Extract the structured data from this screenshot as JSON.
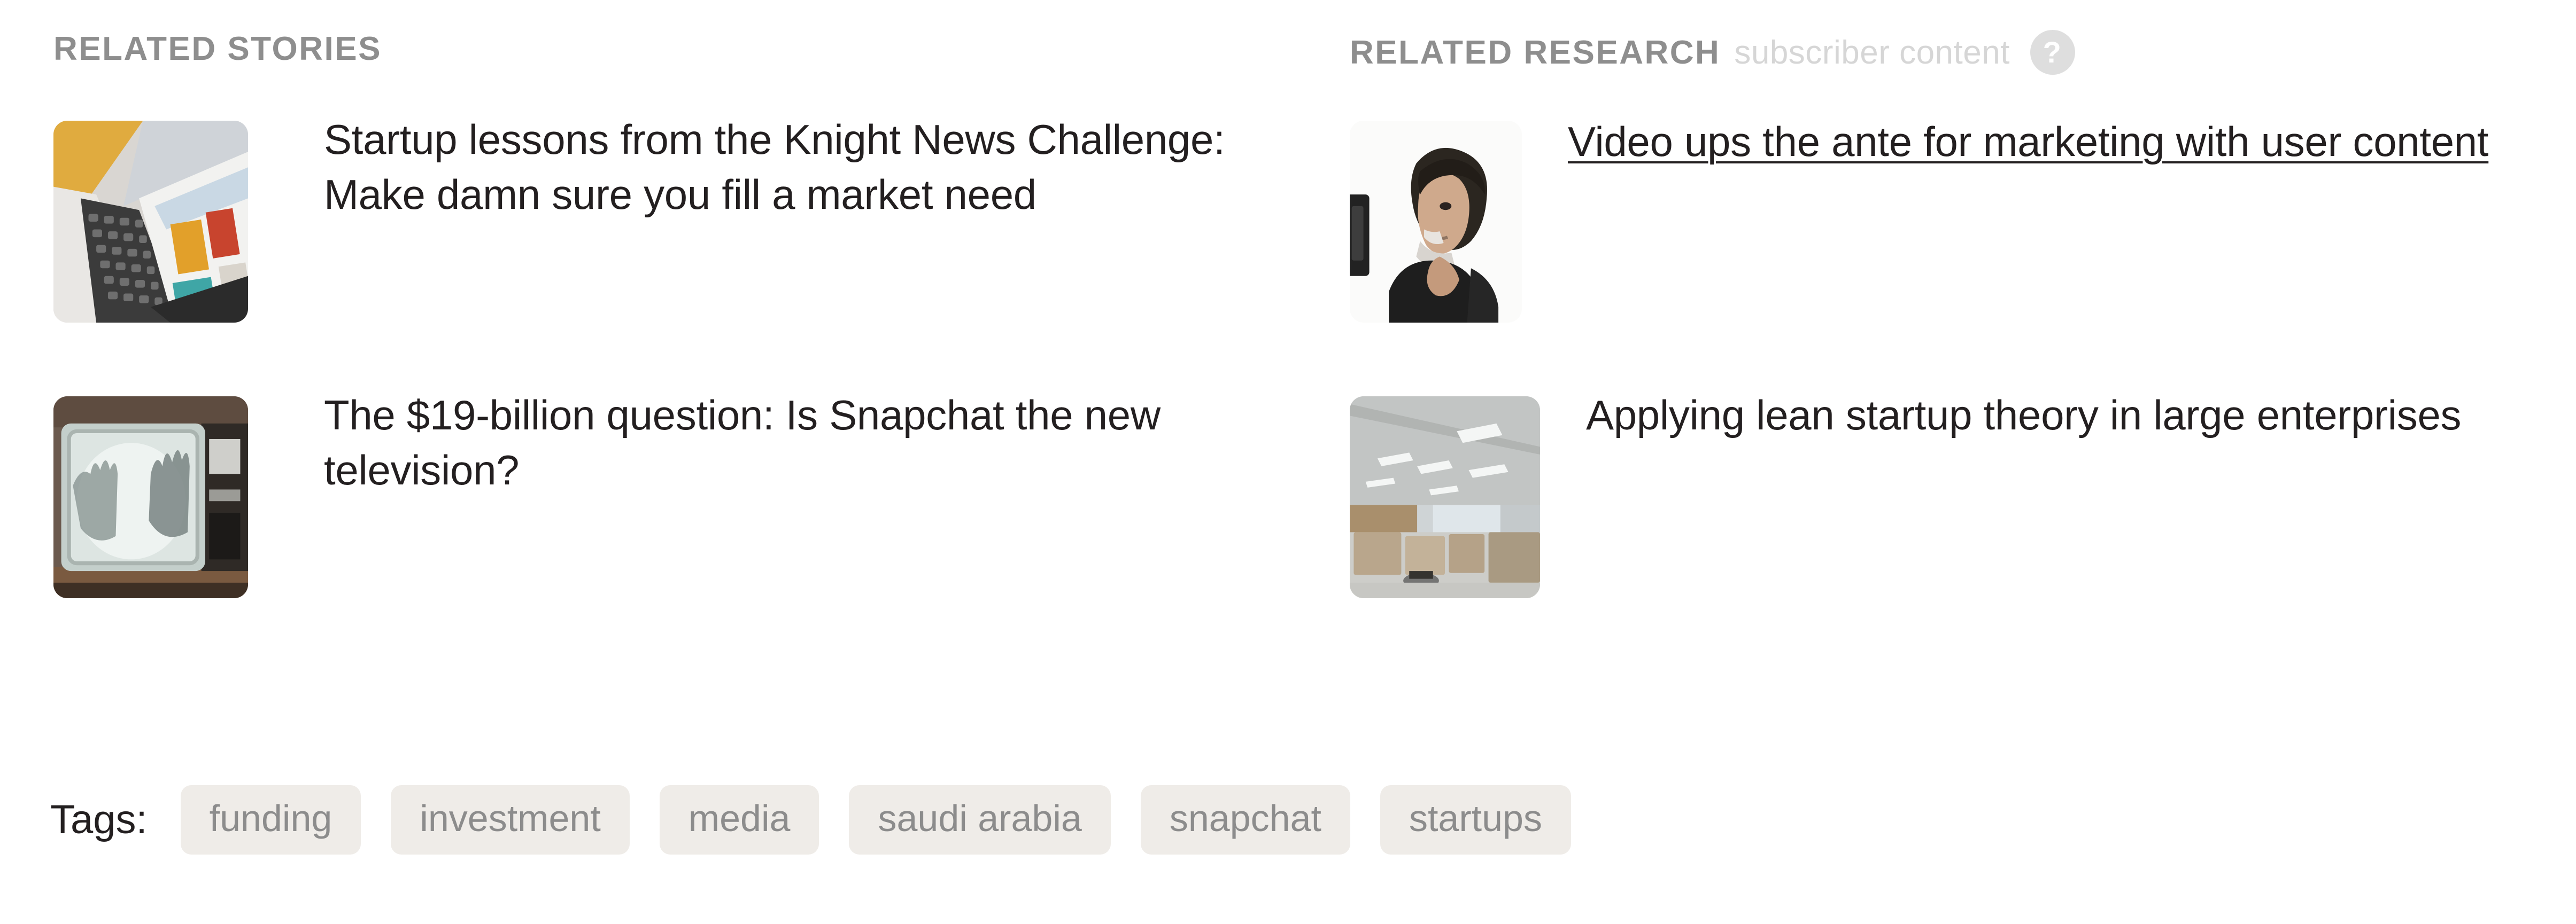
{
  "columns": {
    "stories": {
      "header": "Related Stories",
      "items": [
        {
          "title": "Startup lessons from the Knight News Challenge: Make damn sure you fill a market need",
          "thumb_alt": "laptop-keyboard-and-tablet-thumbnail",
          "linked": false
        },
        {
          "title": "The $19-billion question: Is Snapchat the new television?",
          "thumb_alt": "old-television-with-hands-thumbnail",
          "linked": false
        }
      ]
    },
    "research": {
      "header": "Related Research",
      "subheader": "subscriber content",
      "help_glyph": "?",
      "items": [
        {
          "title": "Video ups the ante for marketing with user content",
          "thumb_alt": "person-holding-phone-thumbnail",
          "linked": true
        },
        {
          "title": "Applying lean startup theory in large enterprises",
          "thumb_alt": "open-plan-office-interior-thumbnail",
          "linked": false
        }
      ]
    }
  },
  "tags": {
    "label": "Tags:",
    "items": [
      "funding",
      "investment",
      "media",
      "saudi arabia",
      "snapchat",
      "startups"
    ]
  },
  "colors": {
    "header_gray": "#8e8e8e",
    "subheader_gray": "#d6d6d6",
    "title_text": "#231f20",
    "tag_bg": "#efece8",
    "tag_text": "#8c8c8c",
    "help_circle": "#dedede"
  }
}
